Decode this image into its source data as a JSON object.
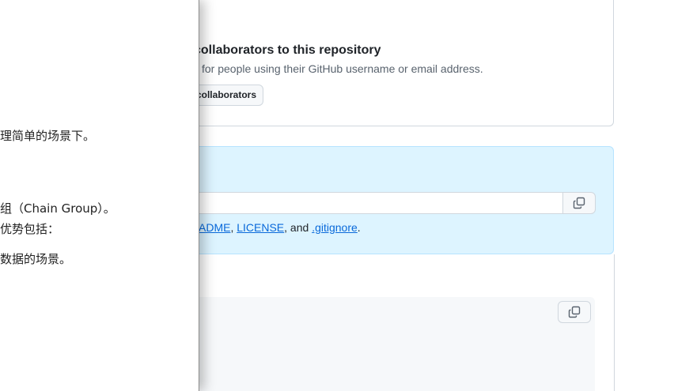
{
  "left_panel": {
    "lines": [
      "理简单的场景下。",
      "组（Chain Group）。",
      "优势包括：",
      "数据的场景。"
    ]
  },
  "collaborators": {
    "title": "collaborators to this repository",
    "description": "for people using their GitHub username or email address.",
    "button_label": "collaborators"
  },
  "quick_setup": {
    "links": {
      "readme": "ADME",
      "sep1": ", ",
      "license": "LICENSE",
      "sep2": ", and ",
      "gitignore": ".gitignore",
      "end": "."
    }
  },
  "icons": {
    "copy": "copy-icon"
  }
}
